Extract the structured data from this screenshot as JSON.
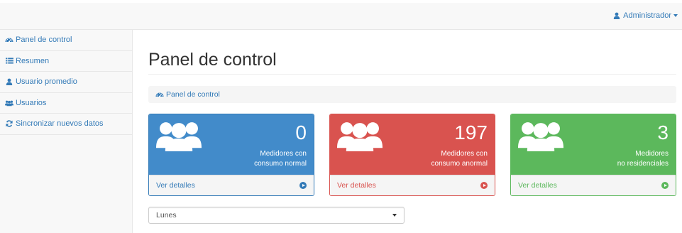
{
  "header": {
    "user_label": "Administrador",
    "user_icon": "user-icon"
  },
  "sidebar": {
    "items": [
      {
        "label": "Panel de control",
        "icon": "dashboard-icon"
      },
      {
        "label": "Resumen",
        "icon": "list-icon"
      },
      {
        "label": "Usuario promedio",
        "icon": "user-icon"
      },
      {
        "label": "Usuarios",
        "icon": "users-icon"
      },
      {
        "label": "Sincronizar nuevos datos",
        "icon": "refresh-icon"
      }
    ]
  },
  "main": {
    "title": "Panel de control",
    "breadcrumb": {
      "label": "Panel de control",
      "icon": "dashboard-icon"
    },
    "cards": [
      {
        "value": "0",
        "line1": "Medidores con",
        "line2": "consumo normal",
        "link": "Ver detalles",
        "color": "#428bca"
      },
      {
        "value": "197",
        "line1": "Medidores con",
        "line2": "consumo anormal",
        "link": "Ver detalles",
        "color": "#d9534f"
      },
      {
        "value": "3",
        "line1": "Medidores",
        "line2": "no residenciales",
        "link": "Ver detalles",
        "color": "#5cb85c"
      }
    ],
    "day_select": {
      "value": "Lunes"
    }
  },
  "colors": {
    "link": "#337ab7",
    "primary": "#428bca",
    "danger": "#d9534f",
    "success": "#5cb85c"
  }
}
